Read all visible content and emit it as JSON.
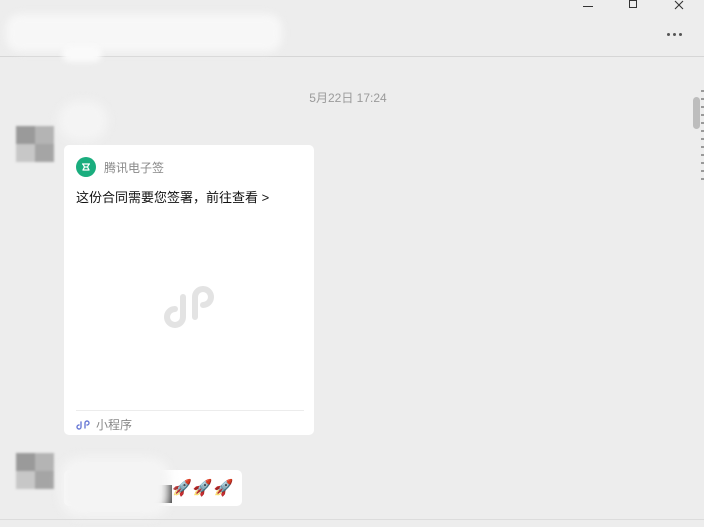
{
  "window": {
    "minimize_glyph": "—",
    "maximize_glyph": "☐",
    "close_glyph": "✕",
    "more_icon": "more-horizontal-icon"
  },
  "chat": {
    "timestamp": "5月22日 17:24",
    "card": {
      "app_name": "腾讯电子签",
      "description": "这份合同需要您签署，前往查看 >",
      "footer_label": "小程序",
      "app_icon": "tencent-esign-icon",
      "app_icon_color": "#1aad7e"
    },
    "message2": {
      "emoji": "🚀🚀🚀"
    }
  }
}
